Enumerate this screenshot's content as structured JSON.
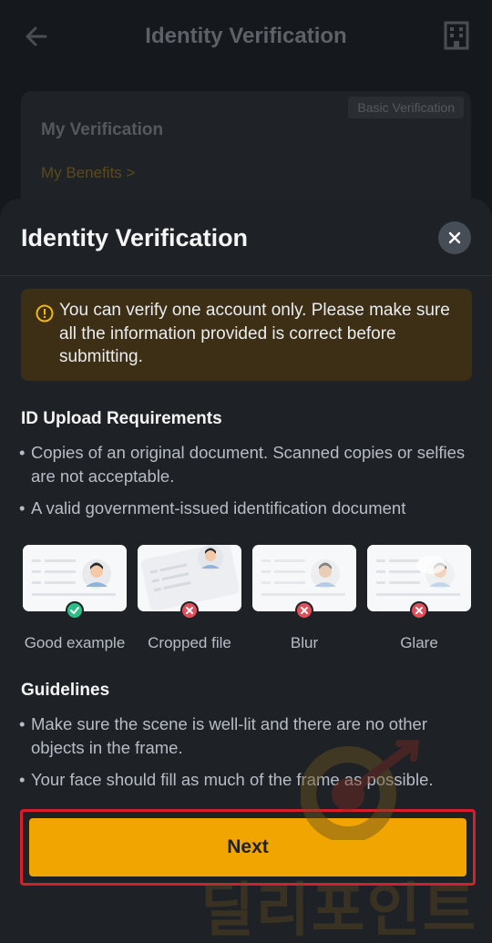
{
  "background": {
    "header": {
      "title": "Identity Verification"
    },
    "card": {
      "title": "My Verification",
      "badge": "Basic Verification",
      "link": "My Benefits  >"
    }
  },
  "sheet": {
    "title": "Identity Verification",
    "warning": "You can verify one account only. Please make sure all the information provided is correct before submitting.",
    "id_requirements": {
      "heading": "ID Upload Requirements",
      "items": [
        "Copies of an original document. Scanned copies or selfies are not acceptable.",
        "A valid government-issued identification document"
      ]
    },
    "examples": [
      {
        "label": "Good example",
        "status": "good"
      },
      {
        "label": "Cropped file",
        "status": "bad"
      },
      {
        "label": "Blur",
        "status": "bad"
      },
      {
        "label": "Glare",
        "status": "bad"
      }
    ],
    "guidelines": {
      "heading": "Guidelines",
      "items": [
        "Make sure the scene is well-lit and there are no other objects in the frame.",
        "Your face should fill as much of the frame as possible."
      ]
    },
    "next_label": "Next"
  },
  "watermark": {
    "text": "딜리포인트"
  },
  "colors": {
    "accent": "#f0a500",
    "good": "#2ebd85",
    "bad": "#e04f5a",
    "highlight": "#d61f2c"
  }
}
